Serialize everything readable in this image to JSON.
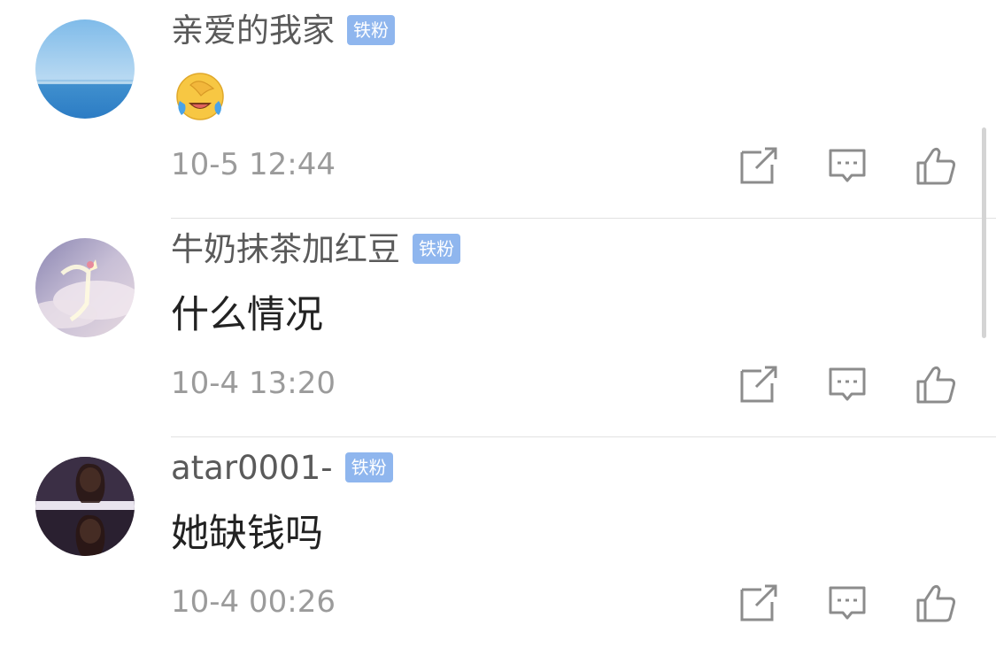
{
  "comments": [
    {
      "username": "亲爱的我家",
      "badge": "铁粉",
      "content_emoji": "laughing-crying-emoji",
      "content": "",
      "timestamp": "10-5 12:44",
      "avatar": "ocean-avatar"
    },
    {
      "username": "牛奶抹茶加红豆",
      "badge": "铁粉",
      "content": "什么情况",
      "timestamp": "10-4 13:20",
      "avatar": "unicorn-clouds-avatar"
    },
    {
      "username": "atar0001-",
      "badge": "铁粉",
      "content": "她缺钱吗",
      "timestamp": "10-4 00:26",
      "avatar": "portrait-avatar"
    }
  ],
  "icons": {
    "edit": "edit-share-icon",
    "reply": "comment-icon",
    "like": "thumbs-up-icon"
  },
  "colors": {
    "badge_bg": "#8fb6ee",
    "username": "#5a5a5a",
    "timestamp": "#9b9b9b",
    "content": "#222222"
  }
}
